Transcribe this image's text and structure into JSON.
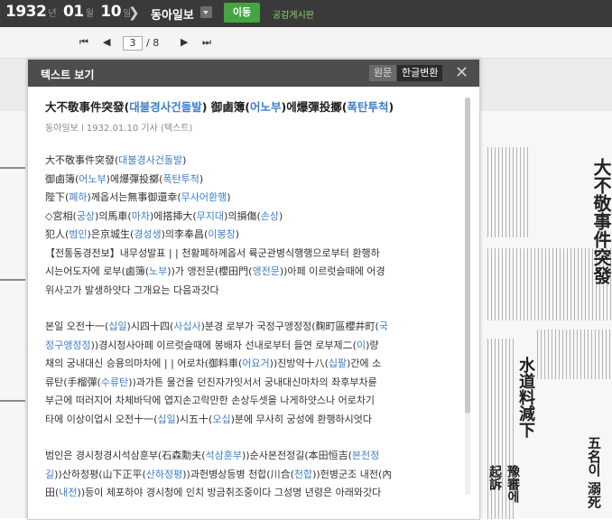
{
  "topbar": {
    "year": "1932",
    "year_unit": "년",
    "month": "01",
    "month_unit": "월",
    "day": "10",
    "day_unit": "일",
    "newspaper": "동아일보",
    "go_label": "이동",
    "board_label": "공감게시판"
  },
  "pager": {
    "current": "3",
    "total": "/ 8"
  },
  "panel": {
    "title": "텍스트 보기",
    "tab_original": "원문",
    "tab_translated": "한글변환",
    "article": {
      "headline": [
        {
          "t": "大不敬事件突發(",
          "k": false
        },
        {
          "t": "대불경사건돌발",
          "k": true
        },
        {
          "t": ") 御鹵簿(",
          "k": false
        },
        {
          "t": "어노부",
          "k": true
        },
        {
          "t": ")에爆彈投擲(",
          "k": false
        },
        {
          "t": "폭탄투척",
          "k": true
        },
        {
          "t": ")",
          "k": false
        }
      ],
      "meta": "동아일보 l 1932.01.10 기사 (텍스트)",
      "lines": [
        [
          {
            "t": "大不敬事件突發(",
            "k": false
          },
          {
            "t": "대불경사건돌발",
            "k": true
          },
          {
            "t": ")",
            "k": false
          }
        ],
        [
          {
            "t": "御鹵簿(",
            "k": false
          },
          {
            "t": "어노부",
            "k": true
          },
          {
            "t": ")에爆彈投擲(",
            "k": false
          },
          {
            "t": "폭탄투척",
            "k": true
          },
          {
            "t": ")",
            "k": false
          }
        ],
        [
          {
            "t": "陛下(",
            "k": false
          },
          {
            "t": "폐하",
            "k": true
          },
          {
            "t": ")께옵서는無事御還幸(",
            "k": false
          },
          {
            "t": "무사어환행",
            "k": true
          },
          {
            "t": ")",
            "k": false
          }
        ],
        [
          {
            "t": "◇宮相(",
            "k": false
          },
          {
            "t": "궁상",
            "k": true
          },
          {
            "t": ")의馬車(",
            "k": false
          },
          {
            "t": "마차",
            "k": true
          },
          {
            "t": ")에搭揷大(",
            "k": false
          },
          {
            "t": "무지대",
            "k": true
          },
          {
            "t": ")의損傷(",
            "k": false
          },
          {
            "t": "손상",
            "k": true
          },
          {
            "t": ")",
            "k": false
          }
        ],
        [
          {
            "t": "犯人(",
            "k": false
          },
          {
            "t": "범인",
            "k": true
          },
          {
            "t": ")은京城生(",
            "k": false
          },
          {
            "t": "경성생",
            "k": true
          },
          {
            "t": ")의李奉昌(",
            "k": false
          },
          {
            "t": "이봉창",
            "k": true
          },
          {
            "t": ")",
            "k": false
          }
        ],
        [
          {
            "t": "【전통동경전보】내무성발표 | | 천황폐하께옵서 륙군관병식행행으로부터 환행하",
            "k": false
          }
        ],
        [
          {
            "t": "시는어도자에 로부(鹵簿(",
            "k": false
          },
          {
            "t": "노부",
            "k": true
          },
          {
            "t": "))가 앵전문(櫻田門(",
            "k": false
          },
          {
            "t": "앵전문",
            "k": true
          },
          {
            "t": "))아페 이르럿슬때에 어경",
            "k": false
          }
        ],
        [
          {
            "t": "위사고가 발생하얏다 그개요는 다음과갓다",
            "k": false
          }
        ]
      ],
      "para2": [
        [
          {
            "t": "본일 오전十一(",
            "k": false
          },
          {
            "t": "십일",
            "k": true
          },
          {
            "t": ")시四十四(",
            "k": false
          },
          {
            "t": "사십사",
            "k": true
          },
          {
            "t": ")분경 로부가 국정구앵정정(麴町區櫻井町(",
            "k": false
          },
          {
            "t": "국",
            "k": true
          }
        ],
        [
          {
            "t": "정구앵정정",
            "k": true
          },
          {
            "t": "))경시청사아페 이르럿슬때에 봉배자 선내로부터 들연 로부제二(",
            "k": false
          },
          {
            "t": "이",
            "k": true
          },
          {
            "t": ")량",
            "k": false
          }
        ],
        [
          {
            "t": "채의 궁내대신 승용의마차에 | | 어로차(御料車(",
            "k": false
          },
          {
            "t": "어요거",
            "k": true
          },
          {
            "t": "))진방약十八(",
            "k": false
          },
          {
            "t": "십팔",
            "k": true
          },
          {
            "t": ")간에 소",
            "k": false
          }
        ],
        [
          {
            "t": "류탄(手榴彈(",
            "k": false
          },
          {
            "t": "수류탄",
            "k": true
          },
          {
            "t": "))과가튼 물건을 던진자가잇서서 궁내대신마차의 좌후부차륜",
            "k": false
          }
        ],
        [
          {
            "t": "부근에 떠러지어 차체바닥에 엽지손고락만한 손상두셋을 나게하얏스나 어로차기",
            "k": false
          }
        ],
        [
          {
            "t": "타에 이상이업시 오전十一(",
            "k": false
          },
          {
            "t": "십일",
            "k": true
          },
          {
            "t": ")시五十(",
            "k": false
          },
          {
            "t": "오십",
            "k": true
          },
          {
            "t": ")분에 무사히 궁성에 환행하시엇다",
            "k": false
          }
        ]
      ],
      "para3": [
        [
          {
            "t": "범인은 경시청경시석삼훈부(石森勳夫(",
            "k": false
          },
          {
            "t": "석삼훈부",
            "k": true
          },
          {
            "t": "))순사본전정길(本田恒吉(",
            "k": false
          },
          {
            "t": "본전정",
            "k": true
          }
        ],
        [
          {
            "t": "길",
            "k": true
          },
          {
            "t": "))산하정평(山下正平(",
            "k": false
          },
          {
            "t": "산하정평",
            "k": true
          },
          {
            "t": "))과헌병상등병 천합(川合(",
            "k": false
          },
          {
            "t": "천합",
            "k": true
          },
          {
            "t": "))헌병군조 내전(內",
            "k": false
          }
        ],
        [
          {
            "t": "田(",
            "k": false
          },
          {
            "t": "내전",
            "k": true
          },
          {
            "t": "))등이 체포하야 경시청에 인치 방금취조중이다 그성명 년령은 아래와갓다",
            "k": false
          }
        ]
      ]
    }
  },
  "newspaper_bg": {
    "head_right": "大不敬事件突發",
    "head_right2": "御鹵簿에 爆彈投擲",
    "sub1": "陛下께옵서는 無事御還幸",
    "sub2": "◇宮相의 馬車에 搭揷大의 損傷",
    "sub3": "犯人은 京城生의 李奉昌",
    "mid_title": "水道料減下",
    "bot1": "五名이 溺死",
    "bot2": "豫審에 起訴"
  }
}
